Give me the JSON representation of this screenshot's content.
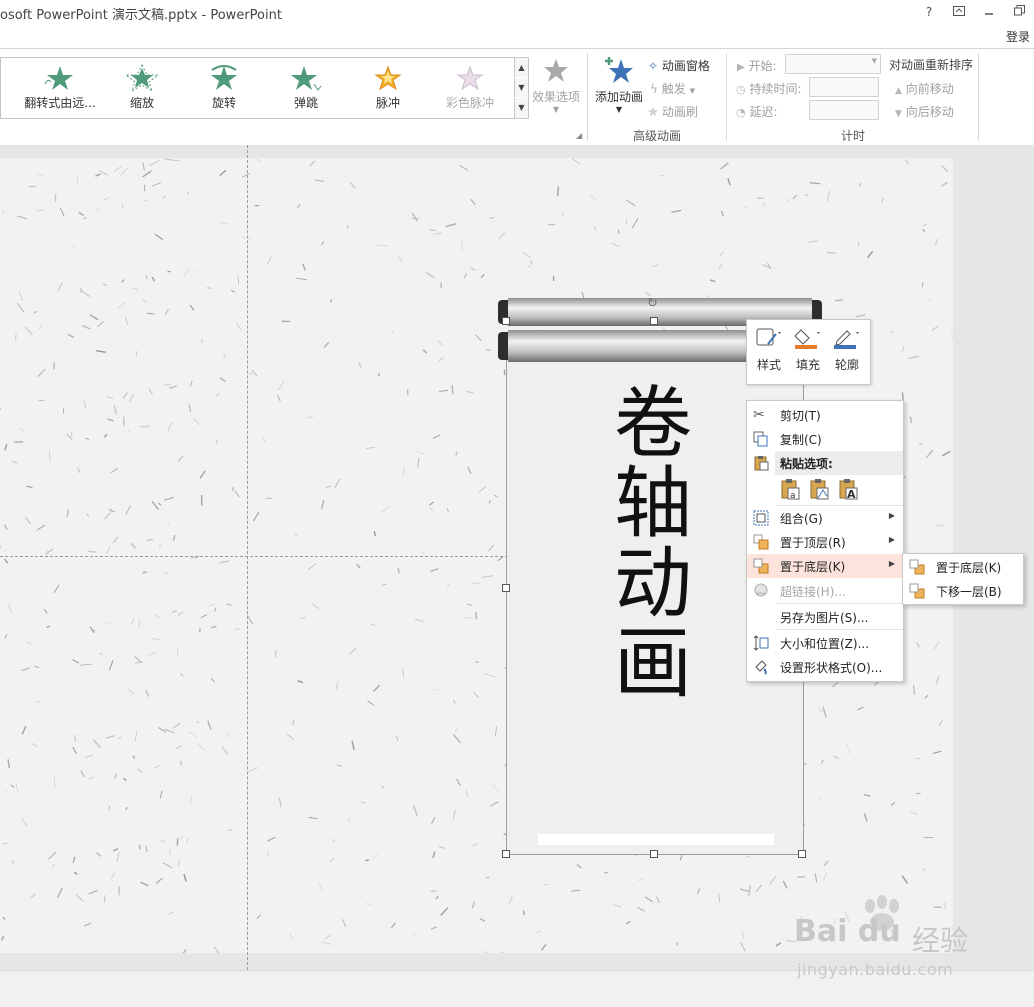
{
  "window": {
    "title": "osoft PowerPoint 演示文稿.pptx - PowerPoint",
    "help_label": "?",
    "login_label": "登录"
  },
  "colors": {
    "accent_green": "#4f9a79",
    "accent_blue": "#3f73b8",
    "highlight": "#fce4dc",
    "slide_bg": "#f2f2f2"
  },
  "ribbon": {
    "gallery_items": [
      {
        "label": "翻转式由远...",
        "icon": "flip-star-icon",
        "dim": false
      },
      {
        "label": "缩放",
        "icon": "zoom-star-icon",
        "dim": false
      },
      {
        "label": "旋转",
        "icon": "spin-star-icon",
        "dim": false
      },
      {
        "label": "弹跳",
        "icon": "bounce-star-icon",
        "dim": false
      },
      {
        "label": "脉冲",
        "icon": "pulse-star-icon",
        "dim": false
      },
      {
        "label": "彩色脉冲",
        "icon": "color-pulse-star-icon",
        "dim": true
      }
    ],
    "effect_options_label": "效果选项",
    "add_animation_label": "添加动画",
    "animation_pane_label": "动画窗格",
    "trigger_label": "触发",
    "painter_label": "动画刷",
    "advanced_group_label": "高级动画",
    "start_label": "开始:",
    "duration_label": "持续时间:",
    "delay_label": "延迟:",
    "timing_group_label": "计时",
    "reorder_title": "对动画重新排序",
    "move_earlier_label": "向前移动",
    "move_later_label": "向后移动"
  },
  "slide": {
    "vertical_text_chars": [
      "卷",
      "轴",
      "动",
      "画"
    ]
  },
  "mini_toolbar": {
    "style_label": "样式",
    "fill_label": "填充",
    "outline_label": "轮廓"
  },
  "context_menu": {
    "cut": "剪切(T)",
    "copy": "复制(C)",
    "paste_options": "粘贴选项:",
    "group": "组合(G)",
    "bring_to_front": "置于顶层(R)",
    "send_to_back": "置于底层(K)",
    "hyperlink": "超链接(H)...",
    "save_as_picture": "另存为图片(S)...",
    "size_position": "大小和位置(Z)...",
    "format_shape": "设置形状格式(O)..."
  },
  "submenu": {
    "send_to_back": "置于底层(K)",
    "send_backward": "下移一层(B)"
  },
  "watermark": {
    "brand": "Bai du",
    "cn": "经验",
    "url": "jingyan.baidu.com"
  }
}
